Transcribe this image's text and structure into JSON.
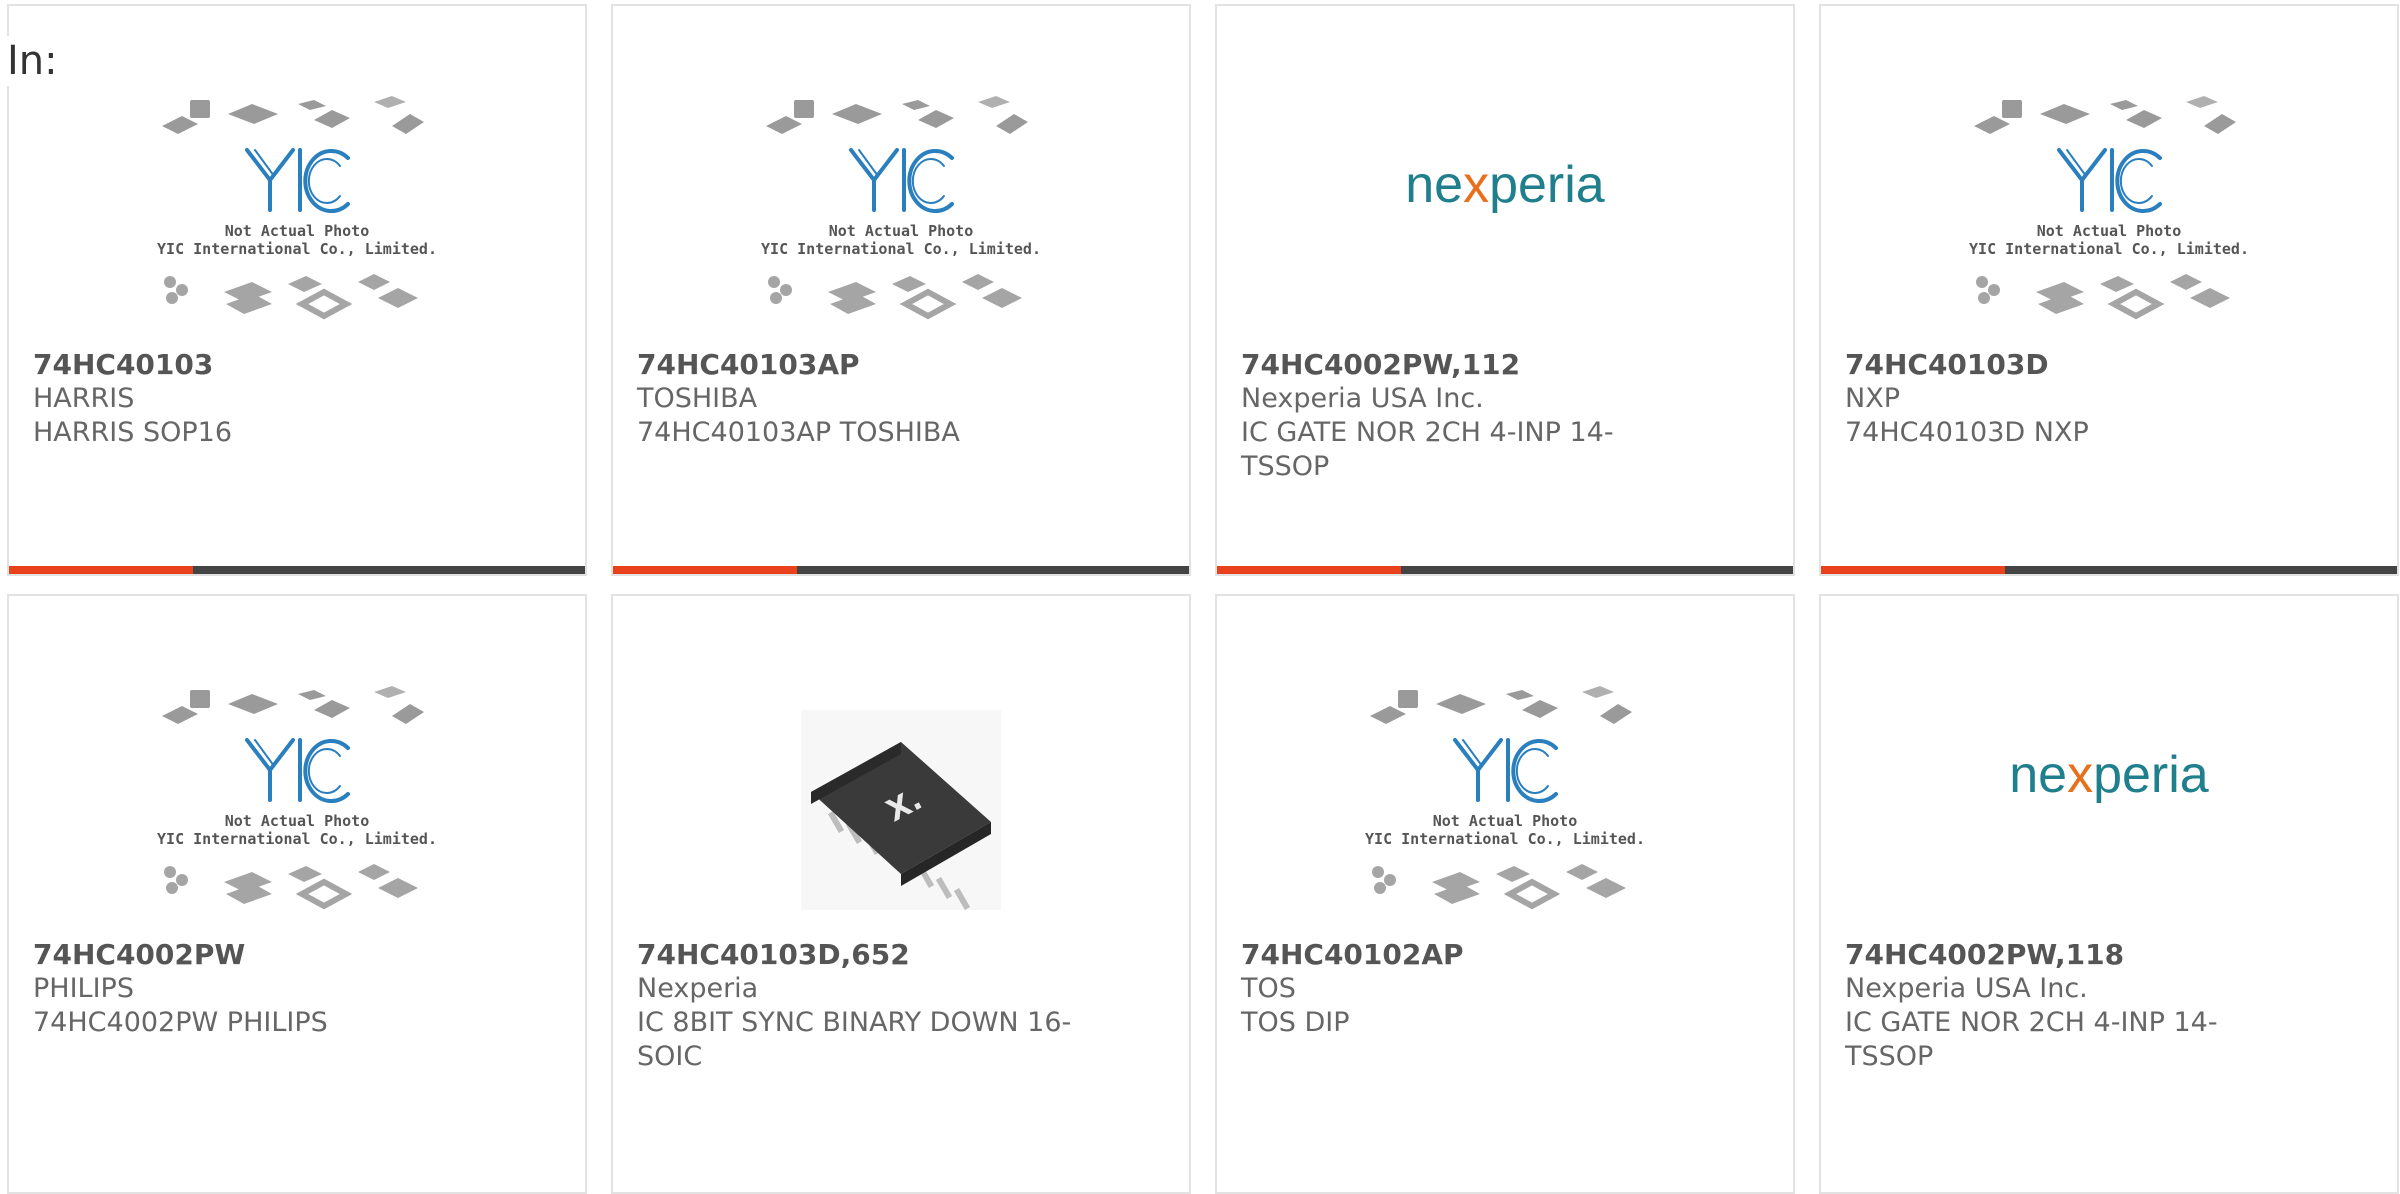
{
  "filter_label": "In:",
  "colors": {
    "accent": "#e8411c",
    "bar": "#444444",
    "nexperia_teal": "#1f7f8c",
    "nexperia_orange": "#e8701c"
  },
  "cards": [
    {
      "part": "74HC40103",
      "manufacturer": "HARRIS",
      "description": "HARRIS SOP16",
      "image": "yic-placeholder",
      "placeholder_line1": "Not Actual Photo",
      "placeholder_line2": "YIC International Co., Limited."
    },
    {
      "part": "74HC40103AP",
      "manufacturer": "TOSHIBA",
      "description": "74HC40103AP TOSHIBA",
      "image": "yic-placeholder",
      "placeholder_line1": "Not Actual Photo",
      "placeholder_line2": "YIC International Co., Limited."
    },
    {
      "part": "74HC4002PW,112",
      "manufacturer": "Nexperia USA Inc.",
      "description": "IC GATE NOR 2CH 4-INP 14-",
      "description2": "TSSOP",
      "image": "nexperia-logo",
      "logo_text_a": "ne",
      "logo_text_b": "x",
      "logo_text_c": "peria"
    },
    {
      "part": "74HC40103D",
      "manufacturer": "NXP",
      "description": "74HC40103D NXP",
      "image": "yic-placeholder",
      "placeholder_line1": "Not Actual Photo",
      "placeholder_line2": "YIC International Co., Limited."
    },
    {
      "part": "74HC4002PW",
      "manufacturer": "PHILIPS",
      "description": "74HC4002PW PHILIPS",
      "image": "yic-placeholder",
      "placeholder_line1": "Not Actual Photo",
      "placeholder_line2": "YIC International Co., Limited."
    },
    {
      "part": "74HC40103D,652",
      "manufacturer": "Nexperia",
      "description": "IC 8BIT SYNC BINARY DOWN 16-",
      "description2": "SOIC",
      "image": "soic-chip-photo"
    },
    {
      "part": "74HC40102AP",
      "manufacturer": "TOS",
      "description": "TOS DIP",
      "image": "yic-placeholder",
      "placeholder_line1": "Not Actual Photo",
      "placeholder_line2": "YIC International Co., Limited."
    },
    {
      "part": "74HC4002PW,118",
      "manufacturer": "Nexperia USA Inc.",
      "description": "IC GATE NOR 2CH 4-INP 14-",
      "description2": "TSSOP",
      "image": "nexperia-logo",
      "logo_text_a": "ne",
      "logo_text_b": "x",
      "logo_text_c": "peria"
    }
  ]
}
